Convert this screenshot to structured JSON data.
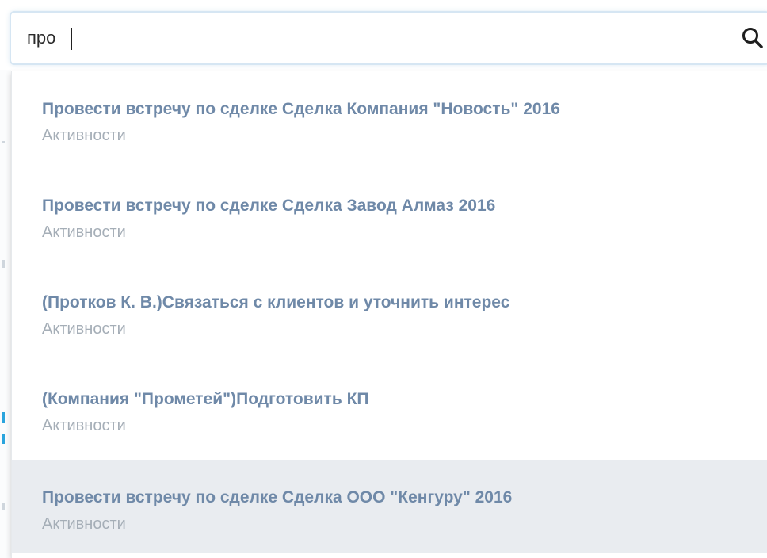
{
  "search": {
    "value": "про",
    "icon": "search-icon"
  },
  "colors": {
    "title": "#6f89a8",
    "subtitle": "#a5aeb7",
    "active_row": "#e9ecf0",
    "input_border": "#d6e6f3"
  },
  "results": [
    {
      "title": "Провести встречу по сделке Сделка Компания \"Новость\" 2016",
      "category": "Активности",
      "active": false
    },
    {
      "title": "Провести встречу по сделке Сделка Завод Алмаз 2016",
      "category": "Активности",
      "active": false
    },
    {
      "title": "(Протков К. В.)Связаться с клиентов и уточнить интерес",
      "category": "Активности",
      "active": false
    },
    {
      "title": "(Компания \"Прометей\")Подготовить КП",
      "category": "Активности",
      "active": false
    },
    {
      "title": "Провести встречу по сделке Сделка ООО \"Кенгуру\" 2016",
      "category": "Активности",
      "active": true
    }
  ]
}
